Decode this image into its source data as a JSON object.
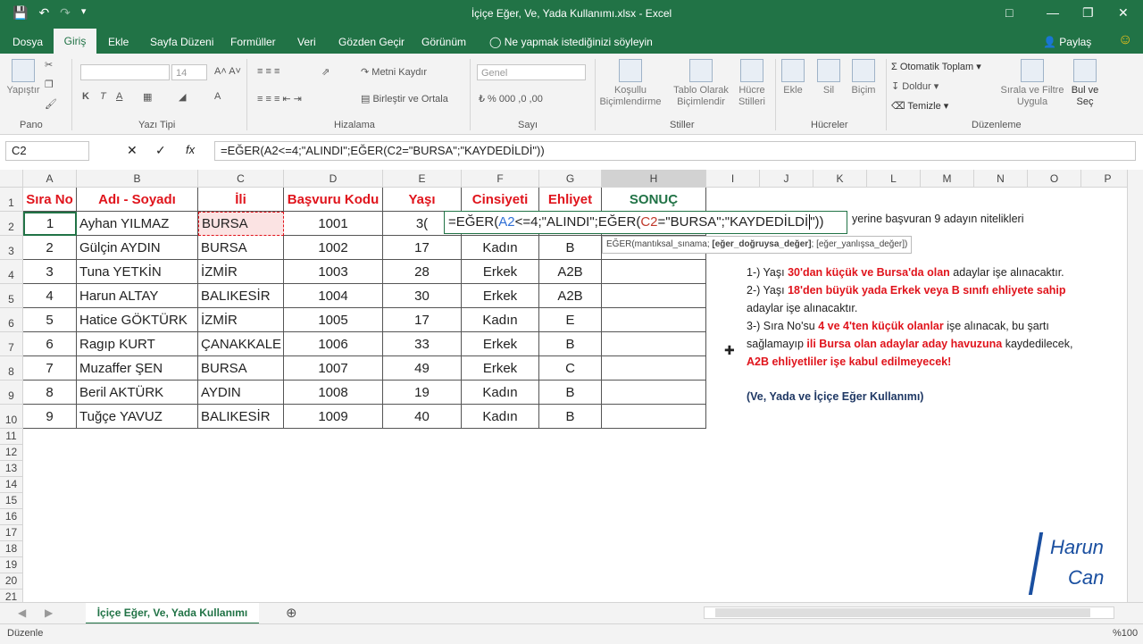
{
  "window": {
    "title": "İçiçe Eğer, Ve, Yada Kullanımı.xlsx - Excel"
  },
  "tabs": [
    "Dosya",
    "Giriş",
    "Ekle",
    "Sayfa Düzeni",
    "Formüller",
    "Veri",
    "Gözden Geçir",
    "Görünüm"
  ],
  "active_tab": "Giriş",
  "tell_me": "Ne yapmak istediğinizi söyleyin",
  "share": "Paylaş",
  "ribbon": {
    "paste": "Yapıştır",
    "font_size": "14",
    "merge": "Metni Kaydır",
    "merge2": "Birleştir ve Ortala",
    "numfmt": "Genel",
    "cond": "Koşullu Biçimlendirme",
    "table": "Tablo Olarak Biçimlendir",
    "styles": "Hücre Stilleri",
    "insert": "Ekle",
    "delete": "Sil",
    "format": "Biçim",
    "autosum": "Otomatik Toplam",
    "fill": "Doldur",
    "clear": "Temizle",
    "sort": "Sırala ve Filtre Uygula",
    "find": "Bul ve Seç",
    "groups": [
      "Pano",
      "Yazı Tipi",
      "Hizalama",
      "Sayı",
      "Stiller",
      "Hücreler",
      "Düzenleme"
    ]
  },
  "formula_bar": {
    "name_box": "C2",
    "formula": "=EĞER(A2<=4;\"ALINDI\";EĞER(C2=\"BURSA\";\"KAYDEDİLDİ\"))"
  },
  "columns": [
    "A",
    "B",
    "C",
    "D",
    "E",
    "F",
    "G",
    "H",
    "I",
    "J",
    "K",
    "L",
    "M",
    "N",
    "O",
    "P"
  ],
  "rows": [
    "1",
    "2",
    "3",
    "4",
    "5",
    "6",
    "7",
    "8",
    "9",
    "10",
    "11",
    "12",
    "13",
    "14",
    "15",
    "16",
    "17",
    "18",
    "19",
    "20",
    "21"
  ],
  "headers": [
    "Sıra No",
    "Adı - Soyadı",
    "İli",
    "Başvuru Kodu",
    "Yaşı",
    "Cinsiyeti",
    "Ehliyet",
    "SONUÇ"
  ],
  "data": [
    [
      "1",
      "Ayhan YILMAZ",
      "BURSA",
      "1001",
      "3(",
      "",
      ""
    ],
    [
      "2",
      "Gülçin AYDIN",
      "BURSA",
      "1002",
      "17",
      "Kadın",
      "B"
    ],
    [
      "3",
      "Tuna YETKİN",
      "İZMİR",
      "1003",
      "28",
      "Erkek",
      "A2B"
    ],
    [
      "4",
      "Harun ALTAY",
      "BALIKESİR",
      "1004",
      "30",
      "Erkek",
      "A2B"
    ],
    [
      "5",
      "Hatice GÖKTÜRK",
      "İZMİR",
      "1005",
      "17",
      "Kadın",
      "E"
    ],
    [
      "6",
      "Ragıp KURT",
      "ÇANAKKALE",
      "1006",
      "33",
      "Erkek",
      "B"
    ],
    [
      "7",
      "Muzaffer ŞEN",
      "BURSA",
      "1007",
      "49",
      "Erkek",
      "C"
    ],
    [
      "8",
      "Beril AKTÜRK",
      "AYDIN",
      "1008",
      "19",
      "Kadın",
      "B"
    ],
    [
      "9",
      "Tuğçe YAVUZ",
      "BALIKESİR",
      "1009",
      "40",
      "Kadın",
      "B"
    ]
  ],
  "edit_formula": {
    "p1": "=EĞER(",
    "a2": "A2",
    "p2": "<=4;\"ALINDI\";EĞER(",
    "c2": "C2",
    "p3": "=\"BURSA\";\"KAYDEDİLDİ",
    "p4": "\"))"
  },
  "tooltip": {
    "a": "EĞER(mantıksal_sınama; ",
    "b": "[eğer_doğruysa_değer]",
    "c": "; [eğer_yanlışsa_değer])"
  },
  "notes": {
    "intro": "yerine başvuran 9 adayın nitelikleri",
    "l1a": "1-) Yaşı ",
    "l1b": "30'dan küçük ve Bursa'da olan",
    "l1c": " adaylar işe alınacaktır.",
    "l2a": "2-) Yaşı ",
    "l2b": "18'den büyük yada Erkek veya B sınıfı ehliyete sahip",
    "l2c": "adaylar işe alınacaktır.",
    "l3a": "3-) Sıra No'su ",
    "l3b": "4 ve 4'ten küçük olanlar",
    "l3c": " işe alınacak, bu şartı",
    "l4a": "sağlamayıp ",
    "l4b": "ili Bursa olan adaylar aday havuzuna",
    "l4c": " kaydedilecek,",
    "l5": "A2B ehliyetliler işe kabul edilmeyecek!",
    "l6": "(Ve, Yada ve İçiçe Eğer Kullanımı)"
  },
  "logo": {
    "a": "Harun",
    "b": "Can"
  },
  "sheet_tab": "İçiçe Eğer, Ve, Yada Kullanımı",
  "status": {
    "mode": "Düzenle",
    "zoom": "%100"
  },
  "colors": {
    "accent": "#217346",
    "header_red": "#e0141c",
    "note_blue": "#1f3864"
  }
}
